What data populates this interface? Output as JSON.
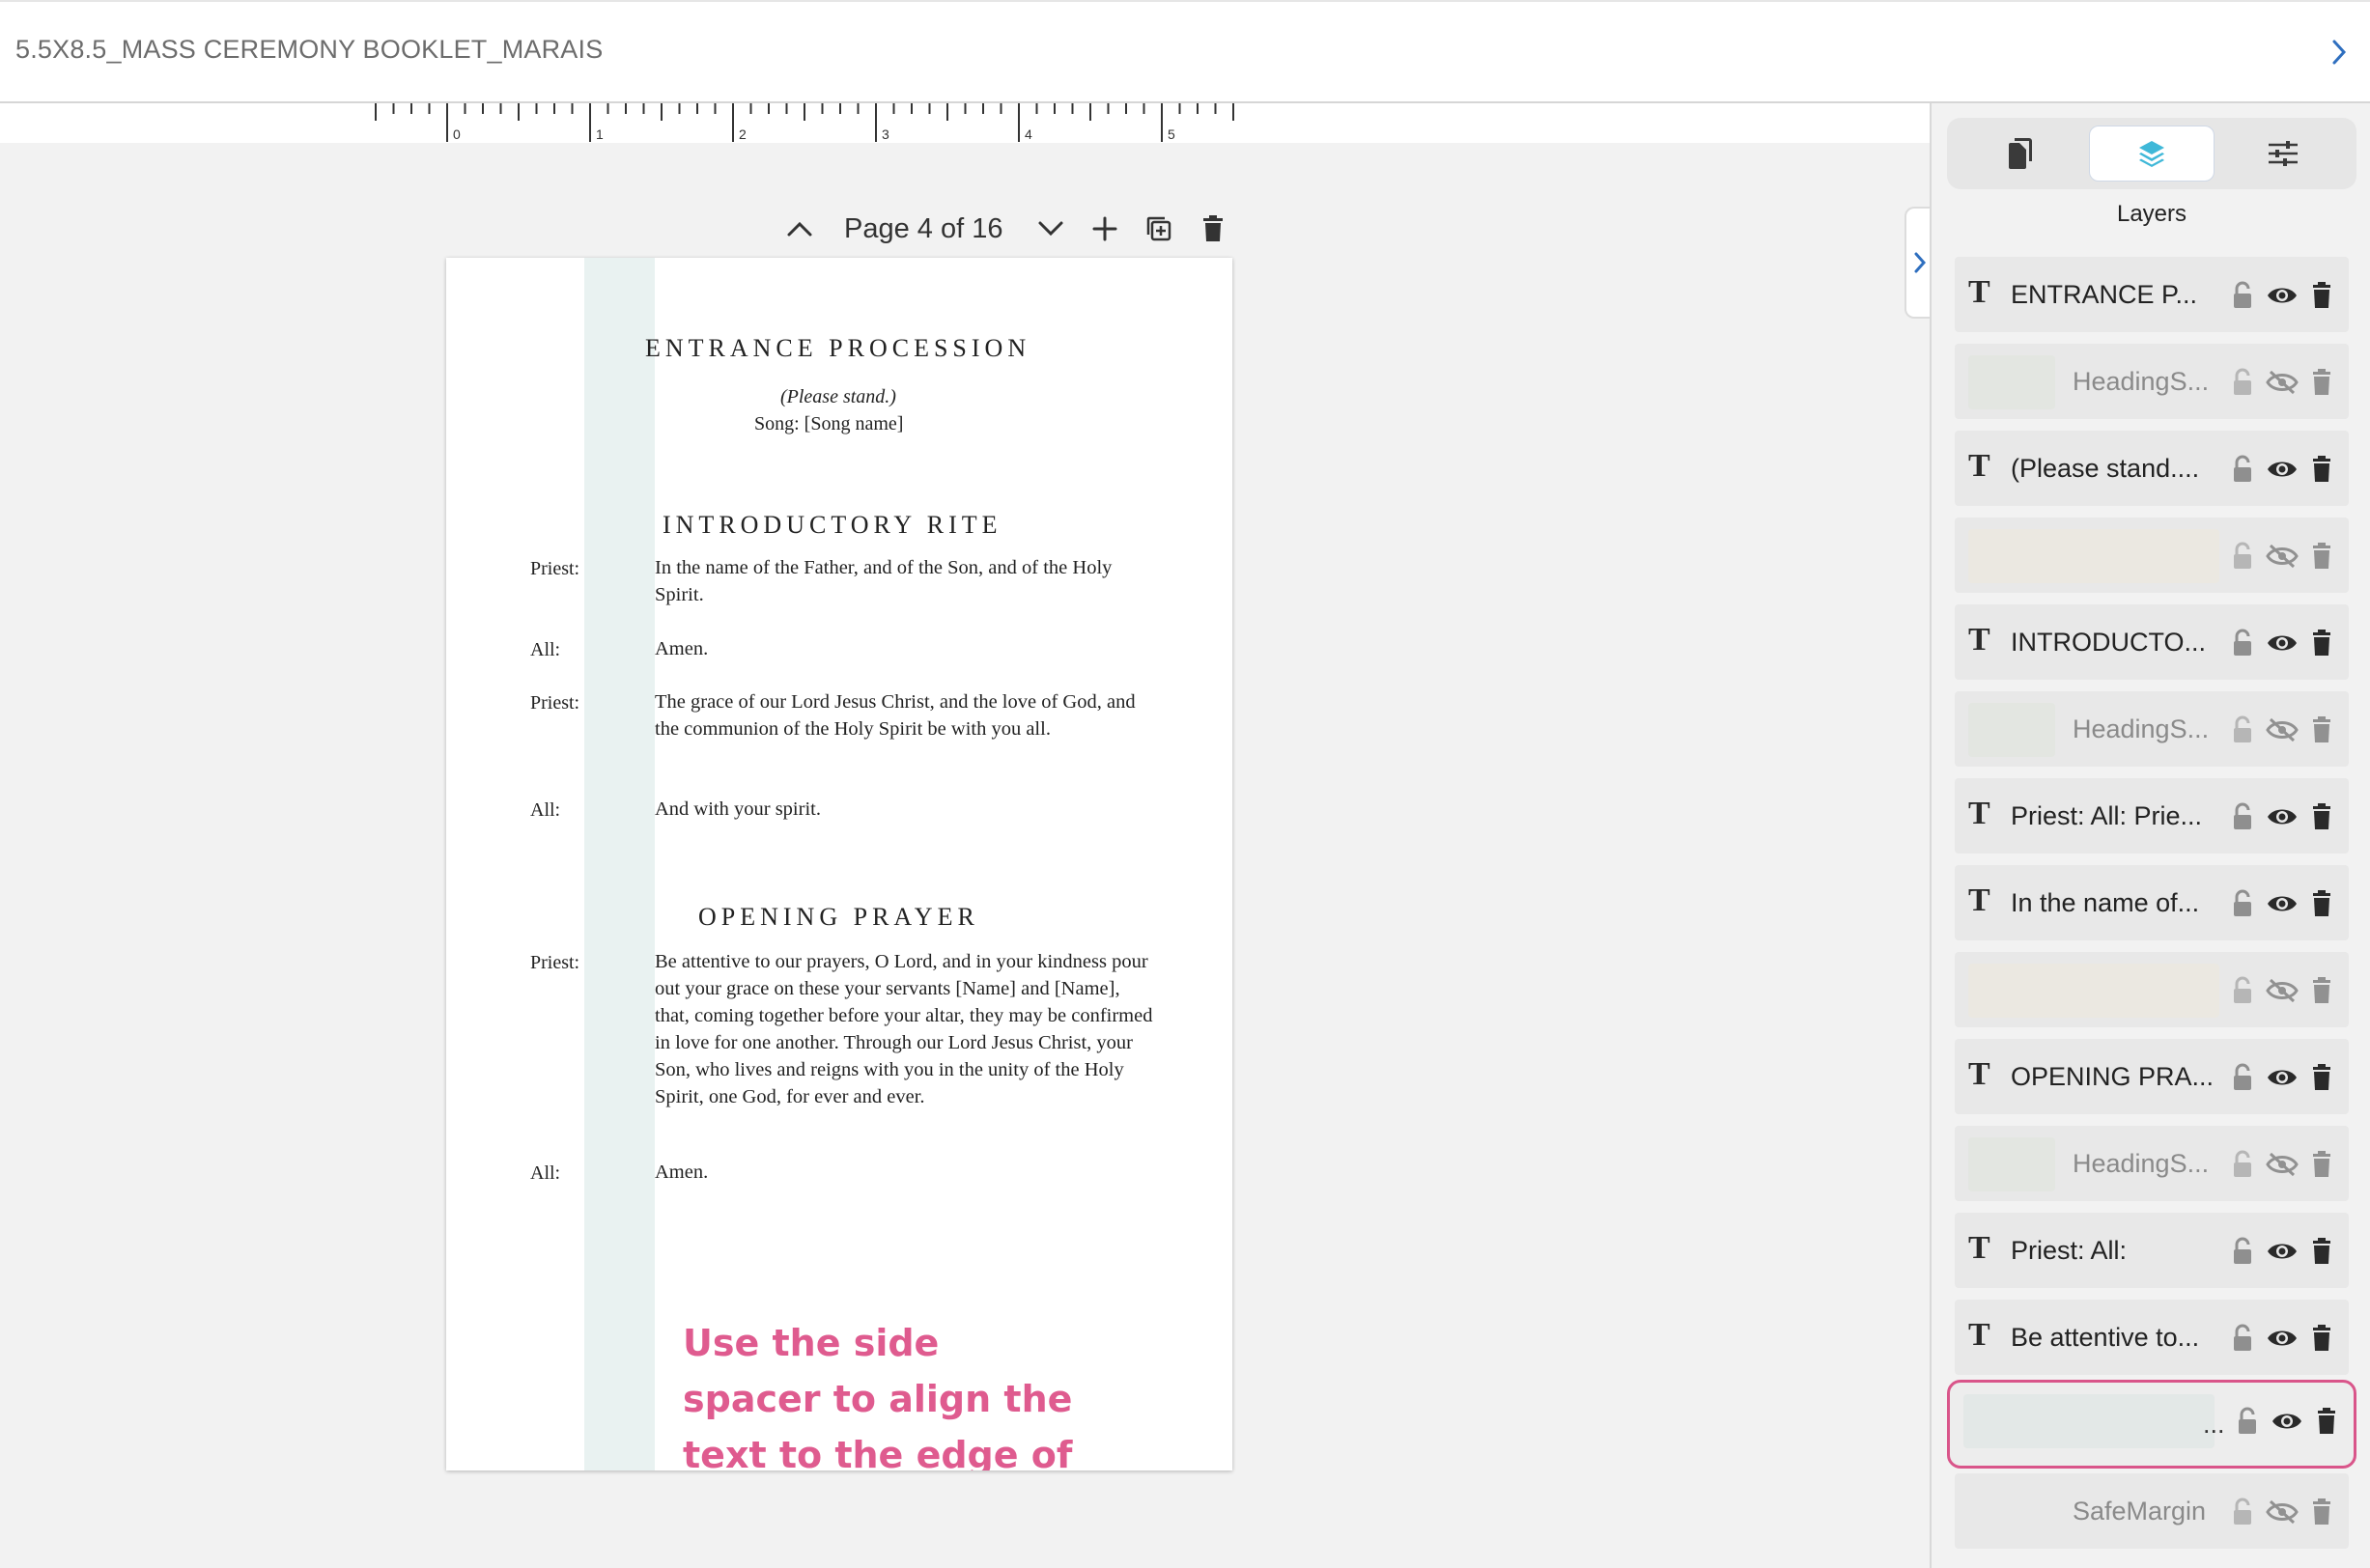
{
  "titlebar": {
    "title": "5.5X8.5_MASS CEREMONY BOOKLET_MARAIS"
  },
  "ruler": {
    "labels": [
      "0",
      "1",
      "2",
      "3",
      "4",
      "5"
    ]
  },
  "page_controls": {
    "indicator": "Page 4 of 16"
  },
  "page": {
    "entrance_heading": "ENTRANCE PROCESSION",
    "please_stand": "(Please stand.)",
    "song": "Song: [Song name]",
    "intro_heading": "INTRODUCTORY RITE",
    "opening_heading": "OPENING PRAYER",
    "dialogue": [
      {
        "speaker": "Priest:",
        "text": "In the name of the Father, and of the Son, and of the Holy Spirit."
      },
      {
        "speaker": "All:",
        "text": "Amen."
      },
      {
        "speaker": "Priest:",
        "text": "The grace of our Lord Jesus Christ, and the love of God, and the communion of the Holy Spirit be with you all."
      },
      {
        "speaker": "All:",
        "text": "And with your spirit."
      },
      {
        "speaker": "Priest:",
        "text": "Be attentive to our prayers, O Lord, and in your kindness pour out your grace on these your servants [Name] and [Name], that, coming together before your altar, they may be confirmed in love for one another. Through our Lord Jesus Christ, your Son, who lives and reigns with you in the unity of the Holy Spirit, one God, for ever and ever."
      },
      {
        "speaker": "All:",
        "text": "Amen."
      }
    ],
    "annotation": "Use the side spacer to align the text to the edge of it."
  },
  "panel": {
    "title": "Layers",
    "tabs": [
      "pages-icon",
      "layers-icon",
      "settings-sliders-icon"
    ],
    "active_tab": 1,
    "layers": [
      {
        "type": "text",
        "label": "ENTRANCE P...",
        "visible": true
      },
      {
        "type": "shape",
        "label": "HeadingS...",
        "visible": false,
        "swatch": "#e3e6e1"
      },
      {
        "type": "text",
        "label": "(Please stand....",
        "visible": true
      },
      {
        "type": "shape",
        "label": "",
        "visible": false,
        "swatch": "#ebe8e1",
        "wide": true
      },
      {
        "type": "text",
        "label": "INTRODUCTO...",
        "visible": true
      },
      {
        "type": "shape",
        "label": "HeadingS...",
        "visible": false,
        "swatch": "#e3e6e1"
      },
      {
        "type": "text",
        "label": "Priest: All: Prie...",
        "visible": true
      },
      {
        "type": "text",
        "label": "In the name of...",
        "visible": true
      },
      {
        "type": "shape",
        "label": "",
        "visible": false,
        "swatch": "#ebe8e1",
        "wide": true
      },
      {
        "type": "text",
        "label": "OPENING PRA...",
        "visible": true
      },
      {
        "type": "shape",
        "label": "HeadingS...",
        "visible": false,
        "swatch": "#e3e6e1"
      },
      {
        "type": "text",
        "label": "Priest: All:",
        "visible": true
      },
      {
        "type": "text",
        "label": "Be attentive to...",
        "visible": true
      },
      {
        "type": "shape",
        "label": "...",
        "visible": true,
        "swatch": "#e3e8e7",
        "wide": true,
        "selected": true
      },
      {
        "type": "shape",
        "label": "SafeMargin",
        "visible": false,
        "swatch": "#e8e8e8"
      }
    ]
  },
  "colors": {
    "accent": "#3fb8d8",
    "annotation": "#df5b8f",
    "spacer": "#e9f2f1",
    "selected_border": "#d9558a"
  }
}
